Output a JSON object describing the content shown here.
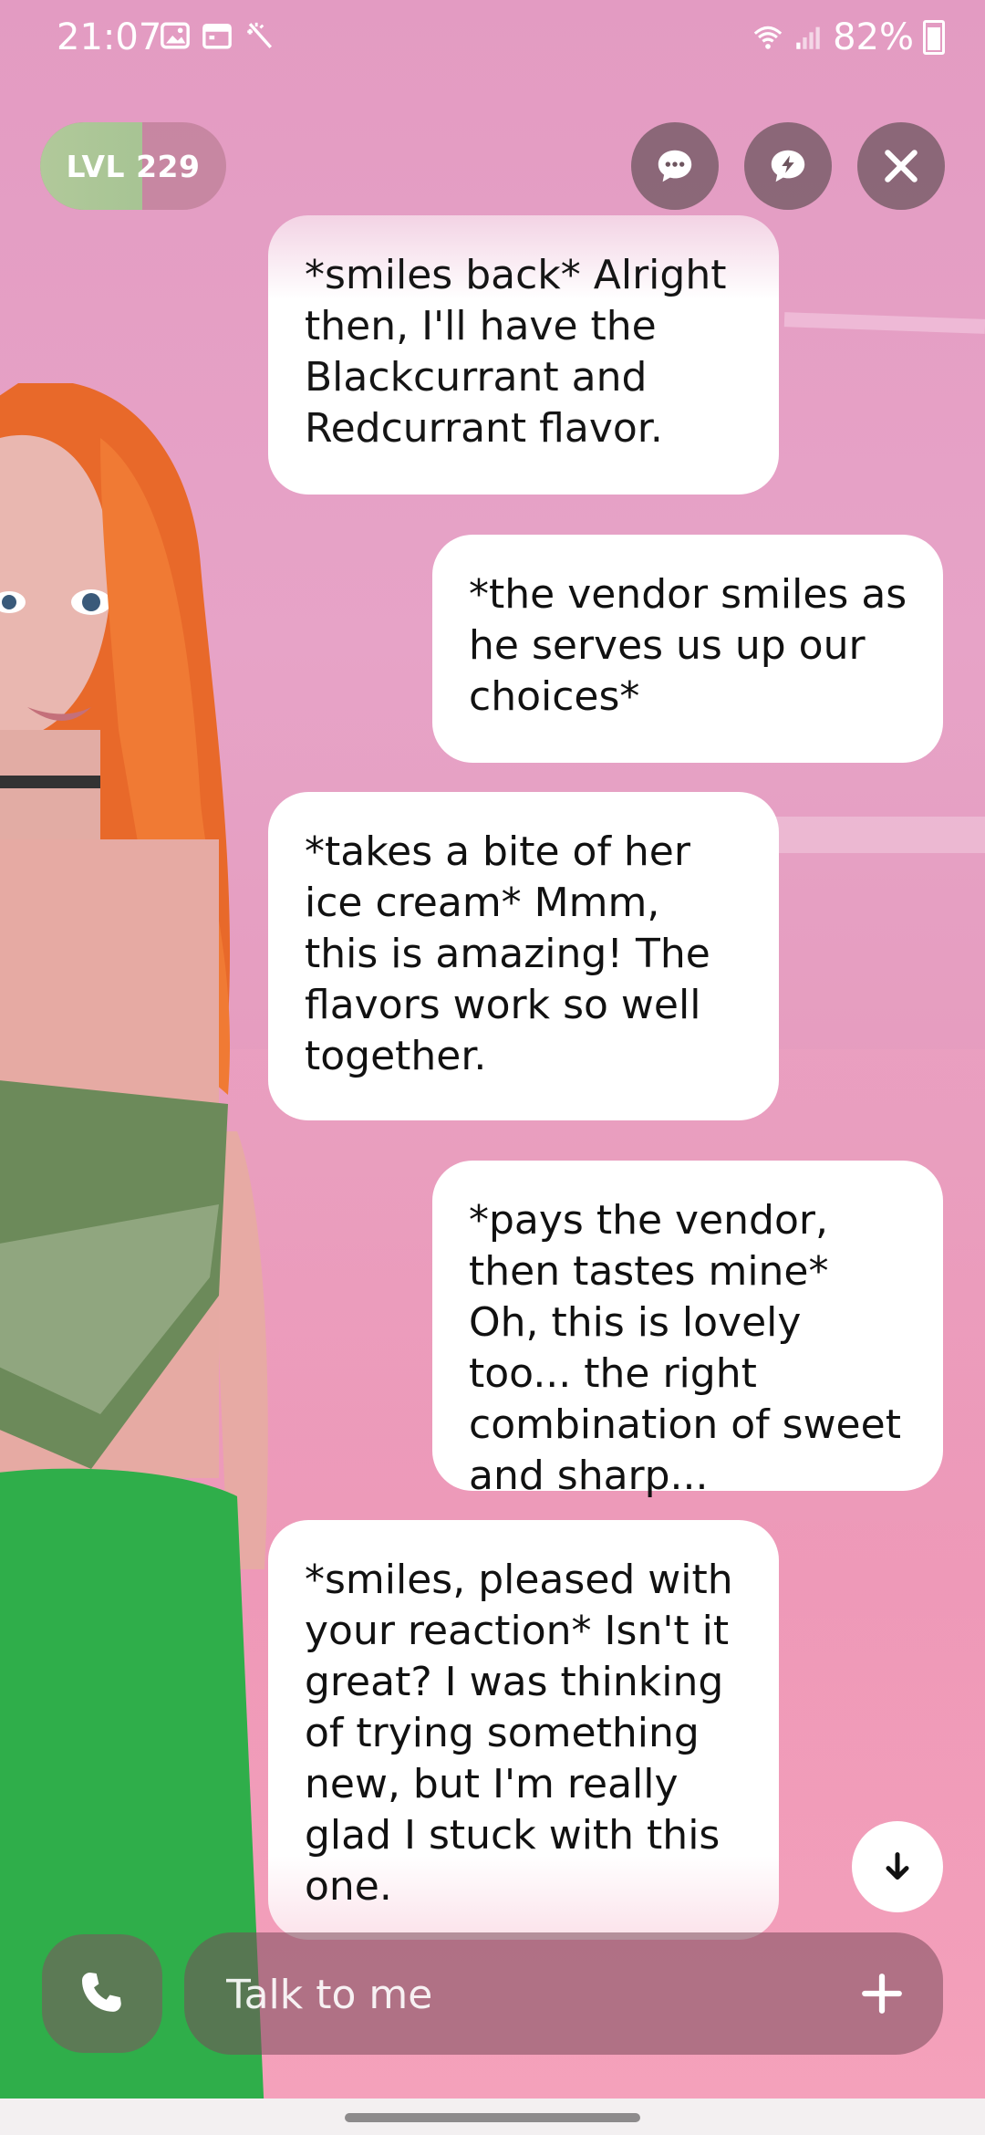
{
  "status_bar": {
    "time": "21:07",
    "battery": "82%",
    "icons": [
      "image-icon",
      "calendar-icon",
      "magic-wand-icon",
      "wifi-icon",
      "signal-icon",
      "battery-icon"
    ]
  },
  "level": {
    "label": "LVL 229",
    "progress": 0.55
  },
  "top_actions": [
    "chat-bubble-icon",
    "lightning-bubble-icon",
    "close-icon"
  ],
  "messages": [
    {
      "side": "left",
      "text": "*smiles back* Alright then, I'll have the Blackcurrant and Redcurrant flavor."
    },
    {
      "side": "right",
      "text": "*the vendor smiles as he serves us up our choices*"
    },
    {
      "side": "left",
      "text": "*takes a bite of her ice cream* Mmm, this is amazing! The flavors work so well together."
    },
    {
      "side": "right",
      "text": "*pays the vendor, then tastes mine* Oh, this is lovely too... the right combination of sweet and sharp..."
    },
    {
      "side": "left",
      "text": "*smiles, pleased with your reaction* Isn't it great? I was thinking of trying something new, but I'm really glad I stuck with this one."
    }
  ],
  "input": {
    "placeholder": "Talk to me",
    "value": ""
  },
  "colors": {
    "background": "#e59bbd",
    "bubble": "#ffffff",
    "control": "#6e555f",
    "level_fill": "#a7c494"
  }
}
